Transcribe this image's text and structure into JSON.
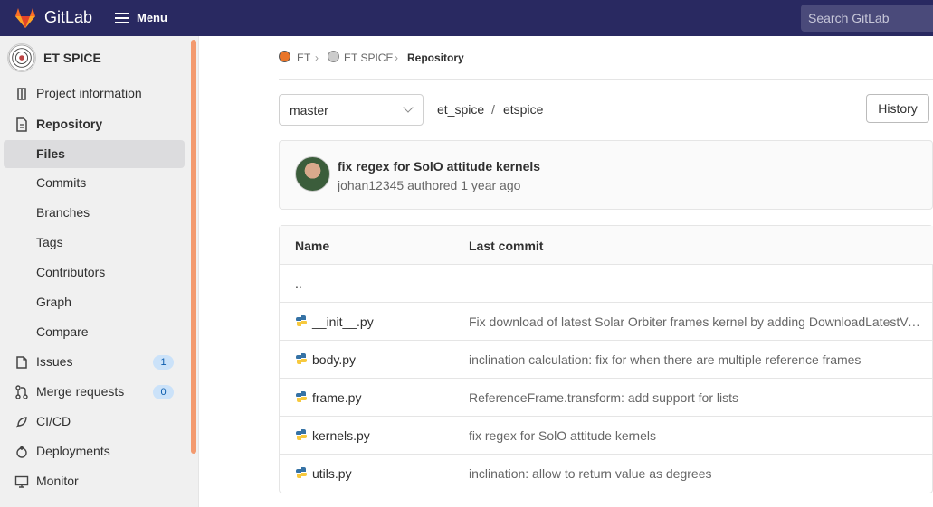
{
  "topbar": {
    "brand": "GitLab",
    "menu_label": "Menu",
    "search_placeholder": "Search GitLab"
  },
  "sidebar": {
    "project_name": "ET SPICE",
    "items": [
      {
        "label": "Project information"
      },
      {
        "label": "Repository"
      },
      {
        "label": "Files"
      },
      {
        "label": "Commits"
      },
      {
        "label": "Branches"
      },
      {
        "label": "Tags"
      },
      {
        "label": "Contributors"
      },
      {
        "label": "Graph"
      },
      {
        "label": "Compare"
      },
      {
        "label": "Issues",
        "count": "1"
      },
      {
        "label": "Merge requests",
        "count": "0"
      },
      {
        "label": "CI/CD"
      },
      {
        "label": "Deployments"
      },
      {
        "label": "Monitor"
      }
    ]
  },
  "breadcrumb": {
    "group": "ET",
    "project": "ET SPICE",
    "current": "Repository"
  },
  "branch": {
    "selected": "master"
  },
  "path": {
    "root": "et_spice",
    "sep": "/",
    "dir": "etspice"
  },
  "history_label": "History",
  "commit": {
    "title": "fix regex for SolO attitude kernels",
    "author": "johan12345",
    "meta_rest": "authored 1 year ago"
  },
  "table": {
    "headers": {
      "name": "Name",
      "last_commit": "Last commit"
    },
    "up": "..",
    "rows": [
      {
        "name": "__init__.py",
        "msg": "Fix download of latest Solar Orbiter frames kernel by adding DownloadLatestVersion"
      },
      {
        "name": "body.py",
        "msg": "inclination calculation: fix for when there are multiple reference frames"
      },
      {
        "name": "frame.py",
        "msg": "ReferenceFrame.transform: add support for lists"
      },
      {
        "name": "kernels.py",
        "msg": "fix regex for SolO attitude kernels"
      },
      {
        "name": "utils.py",
        "msg": "inclination: allow to return value as degrees"
      }
    ]
  },
  "colors": {
    "navbar": "#292961",
    "accent_orange": "#e24329",
    "scrollbar": "#f39a6f",
    "badge_bg": "#cbe2f9"
  }
}
